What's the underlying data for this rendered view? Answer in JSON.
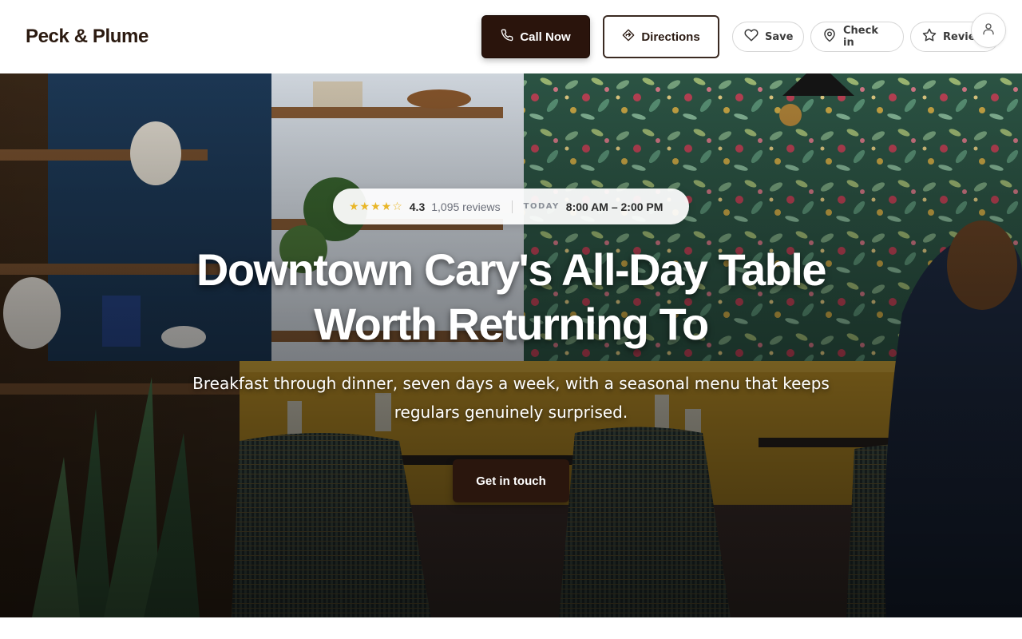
{
  "header": {
    "brand": "Peck & Plume",
    "call_label": "Call Now",
    "directions_label": "Directions",
    "save_label": "Save",
    "checkin_label": "Check in",
    "review_label": "Review"
  },
  "hero": {
    "stars": "★★★★☆",
    "rating": "4.3",
    "reviews": "1,095 reviews",
    "today_label": "TODAY",
    "hours": "8:00 AM – 2:00 PM",
    "headline_line1": "Downtown Cary's All-Day Table",
    "headline_line2": "Worth Returning To",
    "subline_line1": "Breakfast through dinner, seven days a week, with a seasonal menu that keeps",
    "subline_line2": "regulars genuinely surprised.",
    "cta_label": "Get in touch"
  },
  "colors": {
    "brand_dark": "#2a140c",
    "star": "#e9b627",
    "banquette_yellow": "#c99a2a",
    "wallpaper_green": "#3f6b55"
  },
  "icons": {
    "call": "phone-icon",
    "directions": "directions-icon",
    "save": "heart-icon",
    "checkin": "map-pin-icon",
    "review": "star-icon",
    "account": "user-icon"
  }
}
